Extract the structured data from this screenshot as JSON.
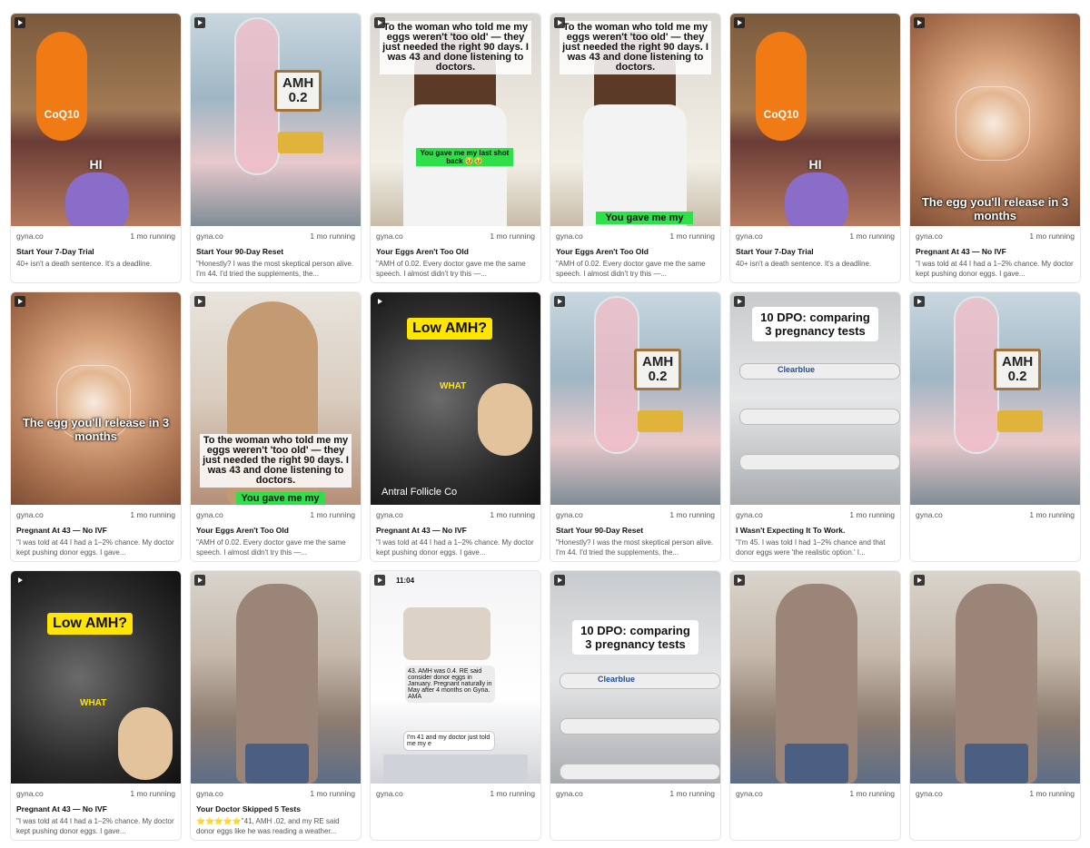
{
  "colors": {
    "card_border": "#e6e6e6",
    "title": "#111111",
    "muted": "#555555",
    "accent_green": "#2ee04a",
    "accent_yellow": "#ffe500"
  },
  "cards": [
    {
      "advertiser": "gyna.co",
      "status": "1 mo running",
      "title": "Start Your 7-Day Trial",
      "body": "40+ isn't a death sentence. It's a deadline.",
      "overlay": "HI",
      "thumb": "coq10"
    },
    {
      "advertiser": "gyna.co",
      "status": "1 mo running",
      "title": "Start Your 90-Day Reset",
      "body": "\"Honestly? I was the most skeptical person alive. I'm 44. I'd tried the supplements, the...",
      "overlay": "AMH 0.2",
      "thumb": "amh"
    },
    {
      "advertiser": "gyna.co",
      "status": "1 mo running",
      "title": "Your Eggs Aren't Too Old",
      "body": "\"AMH of 0.02. Every doctor gave me the same speech. I almost didn't try this —...",
      "overlay": "To the woman who told me my eggs weren't 'too old' — they just needed the right 90 days. I was 43 and done listening to doctors.",
      "overlay2": "You gave me my last shot back 🥹🥹",
      "thumb": "woman"
    },
    {
      "advertiser": "gyna.co",
      "status": "1 mo running",
      "title": "Your Eggs Aren't Too Old",
      "body": "\"AMH of 0.02. Every doctor gave me the same speech. I almost didn't try this —...",
      "overlay": "To the woman who told me my eggs weren't 'too old' — they just needed the right 90 days. I was 43 and done listening to doctors.",
      "overlay2": "You gave me my",
      "thumb": "woman"
    },
    {
      "advertiser": "gyna.co",
      "status": "1 mo running",
      "title": "Start Your 7-Day Trial",
      "body": "40+ isn't a death sentence. It's a deadline.",
      "overlay": "HI",
      "thumb": "coq10"
    },
    {
      "advertiser": "gyna.co",
      "status": "1 mo running",
      "title": "Pregnant At 43 — No IVF",
      "body": "\"I was told at 44 I had a 1–2% chance. My doctor kept pushing donor eggs. I gave...",
      "overlay": "The egg you'll release in 3 months",
      "thumb": "egg"
    },
    {
      "advertiser": "gyna.co",
      "status": "1 mo running",
      "title": "Pregnant At 43 — No IVF",
      "body": "\"I was told at 44 I had a 1–2% chance. My doctor kept pushing donor eggs. I gave...",
      "overlay": "The egg you'll release in 3 months",
      "thumb": "egg"
    },
    {
      "advertiser": "gyna.co",
      "status": "1 mo running",
      "title": "Your Eggs Aren't Too Old",
      "body": "\"AMH of 0.02. Every doctor gave me the same speech. I almost didn't try this —...",
      "overlay": "To the woman who told me my eggs weren't 'too old' — they just needed the right 90 days. I was 43 and done listening to doctors.",
      "overlay2": "You gave me my",
      "thumb": "blonde"
    },
    {
      "advertiser": "gyna.co",
      "status": "1 mo running",
      "title": "Pregnant At 43 — No IVF",
      "body": "\"I was told at 44 I had a 1–2% chance. My doctor kept pushing donor eggs. I gave...",
      "overlay": "Low AMH?",
      "overlay2": "WHAT",
      "overlay3": "Antral Follicle Co",
      "thumb": "ultrasound"
    },
    {
      "advertiser": "gyna.co",
      "status": "1 mo running",
      "title": "Start Your 90-Day Reset",
      "body": "\"Honestly? I was the most skeptical person alive. I'm 44. I'd tried the supplements, the...",
      "overlay": "AMH 0.2",
      "thumb": "amh"
    },
    {
      "advertiser": "gyna.co",
      "status": "1 mo running",
      "title": "I Wasn't Expecting It To Work.",
      "body": "\"I'm 45. I was told I had 1–2% chance and that donor eggs were 'the realistic option.' I...",
      "overlay": "10 DPO: comparing 3 pregnancy tests",
      "overlay2": "Clearblue",
      "thumb": "tests"
    },
    {
      "advertiser": "gyna.co",
      "status": "1 mo running",
      "title": "",
      "body": "",
      "overlay": "AMH 0.2",
      "thumb": "amh"
    },
    {
      "advertiser": "gyna.co",
      "status": "1 mo running",
      "title": "Pregnant At 43 — No IVF",
      "body": "\"I was told at 44 I had a 1–2% chance. My doctor kept pushing donor eggs. I gave...",
      "overlay": "Low AMH?",
      "overlay2": "WHAT",
      "overlay3": "",
      "thumb": "ultrasound"
    },
    {
      "advertiser": "gyna.co",
      "status": "1 mo running",
      "title": "Your Doctor Skipped 5 Tests",
      "body": "⭐⭐⭐⭐⭐\"41, AMH .02, and my RE said donor eggs like he was reading a weather...",
      "overlay": "",
      "thumb": "pregnant"
    },
    {
      "advertiser": "gyna.co",
      "status": "1 mo running",
      "title": "",
      "body": "",
      "overlay": "43. AMH was 0.4. RE said consider donor eggs in January. Pregnant naturally in May after 4 months on Gyna. AMA",
      "overlay2": "I'm 41 and my doctor just told me my e",
      "overlay3": "11:04",
      "thumb": "chat"
    },
    {
      "advertiser": "gyna.co",
      "status": "1 mo running",
      "title": "",
      "body": "",
      "overlay": "10 DPO: comparing 3 pregnancy tests",
      "overlay2": "Clearblue",
      "thumb": "tests"
    },
    {
      "advertiser": "gyna.co",
      "status": "1 mo running",
      "title": "",
      "body": "",
      "overlay": "",
      "thumb": "pregnant"
    },
    {
      "advertiser": "gyna.co",
      "status": "1 mo running",
      "title": "",
      "body": "",
      "overlay": "",
      "thumb": "pregnant"
    }
  ]
}
